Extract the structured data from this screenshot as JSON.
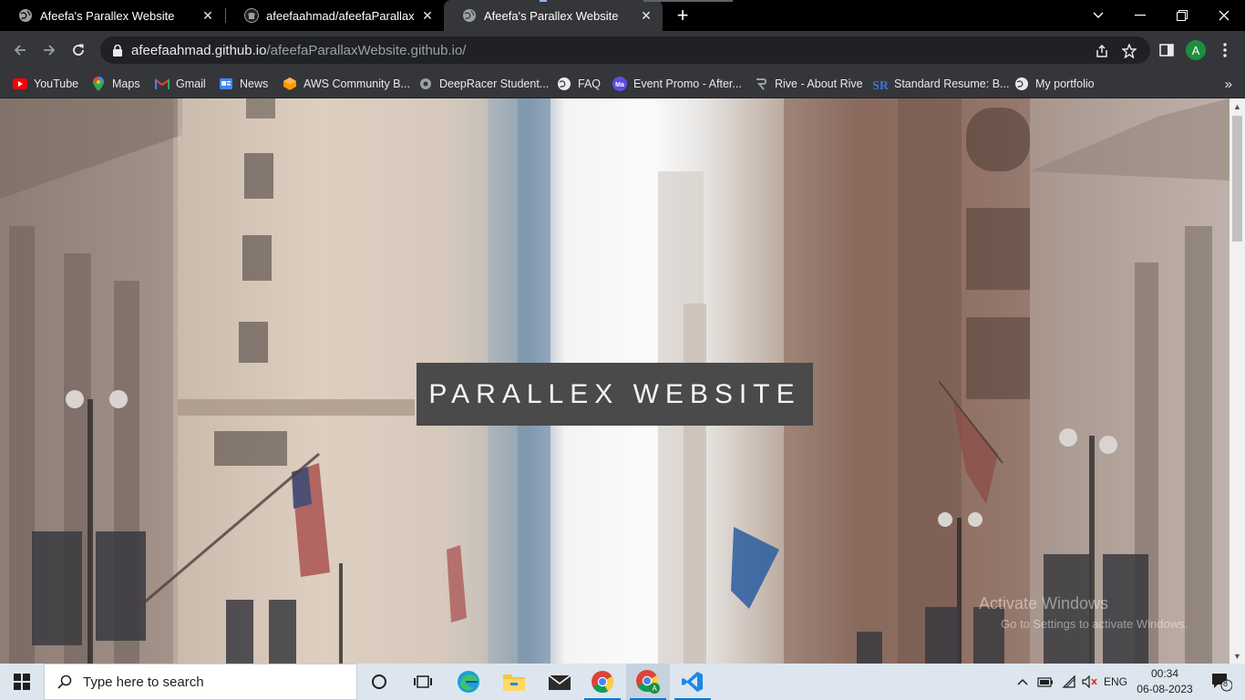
{
  "browser": {
    "tabs": [
      {
        "title": "Afeefa's Parallex Website",
        "icon": "globe-icon",
        "active": false
      },
      {
        "title": "afeefaahmad/afeefaParallaxWebsite",
        "icon": "github-icon",
        "active": false
      },
      {
        "title": "Afeefa's Parallex Website",
        "icon": "globe-icon",
        "active": true
      }
    ],
    "new_tab_label": "+",
    "url": {
      "host": "afeefaahmad.github.io",
      "path": "/afeefaParallaxWebsite.github.io/"
    },
    "profile_initial": "A",
    "bookmarks": [
      {
        "label": "YouTube",
        "icon": "youtube-icon"
      },
      {
        "label": "Maps",
        "icon": "maps-icon"
      },
      {
        "label": "Gmail",
        "icon": "gmail-icon"
      },
      {
        "label": "News",
        "icon": "news-icon"
      },
      {
        "label": "AWS Community B...",
        "icon": "aws-icon"
      },
      {
        "label": "DeepRacer Student...",
        "icon": "deepracer-icon"
      },
      {
        "label": "FAQ",
        "icon": "globe-icon"
      },
      {
        "label": "Event Promo - After...",
        "icon": "event-icon"
      },
      {
        "label": "Rive - About Rive",
        "icon": "rive-icon"
      },
      {
        "label": "Standard Resume: B...",
        "icon": "resume-icon"
      },
      {
        "label": "My portfolio",
        "icon": "globe-icon"
      }
    ],
    "bookmarks_more": "»"
  },
  "page": {
    "hero_title": "PARALLEX WEBSITE",
    "watermark_line1": "Activate Windows",
    "watermark_line2": "Go to Settings to activate Windows."
  },
  "taskbar": {
    "search_placeholder": "Type here to search",
    "language": "ENG",
    "time": "00:34",
    "date": "06-08-2023",
    "notification_count": "8"
  },
  "colors": {
    "tabstrip": "#000000",
    "toolbar": "#35363a",
    "omnibox": "#202124",
    "hero_box": "#4a4a4a",
    "taskbar": "#dde6ee",
    "accent": "#0078d4"
  }
}
